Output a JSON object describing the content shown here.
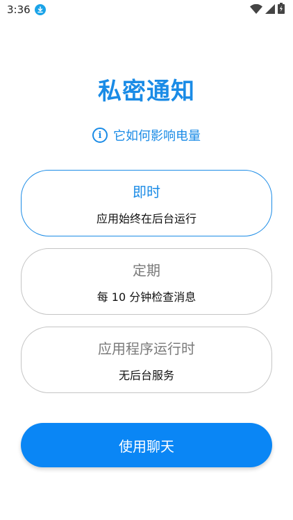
{
  "status_bar": {
    "time": "3:36",
    "icons": [
      "download-icon",
      "wifi-icon",
      "signal-icon",
      "battery-charging-icon"
    ]
  },
  "page": {
    "title": "私密通知",
    "battery_link": "它如何影响电量",
    "info_glyph": "i"
  },
  "options": [
    {
      "title": "即时",
      "description": "应用始终在后台运行",
      "selected": true
    },
    {
      "title": "定期",
      "description": "每 10 分钟检查消息",
      "selected": false
    },
    {
      "title": "应用程序运行时",
      "description": "无后台服务",
      "selected": false
    }
  ],
  "primary_button": {
    "label": "使用聊天"
  },
  "colors": {
    "accent": "#1a8be6",
    "button": "#0a86f5",
    "border": "#c4c4c4",
    "download_badge": "#1aa3e8"
  }
}
